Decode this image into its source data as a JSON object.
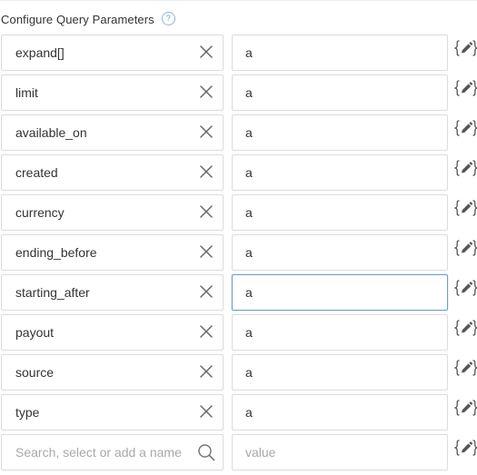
{
  "header": {
    "title": "Configure Query Parameters",
    "help_glyph": "?"
  },
  "params": [
    {
      "name": "expand[]",
      "value": "a"
    },
    {
      "name": "limit",
      "value": "a"
    },
    {
      "name": "available_on",
      "value": "a"
    },
    {
      "name": "created",
      "value": "a"
    },
    {
      "name": "currency",
      "value": "a"
    },
    {
      "name": "ending_before",
      "value": "a"
    },
    {
      "name": "starting_after",
      "value": "a"
    },
    {
      "name": "payout",
      "value": "a"
    },
    {
      "name": "source",
      "value": "a"
    },
    {
      "name": "type",
      "value": "a"
    }
  ],
  "focused_row": 6,
  "new_param": {
    "name_placeholder": "Search, select or add a name",
    "value_placeholder": "value"
  },
  "icons": {
    "clear": "close-x-icon",
    "search": "search-icon",
    "expression": "braces-pencil-icon",
    "help": "question-circle-icon"
  },
  "colors": {
    "border": "#dcdcdc",
    "focus_border": "#6a9fd4",
    "text": "#333333",
    "placeholder": "#a8a8a8",
    "help_icon": "#6a9fc9"
  }
}
